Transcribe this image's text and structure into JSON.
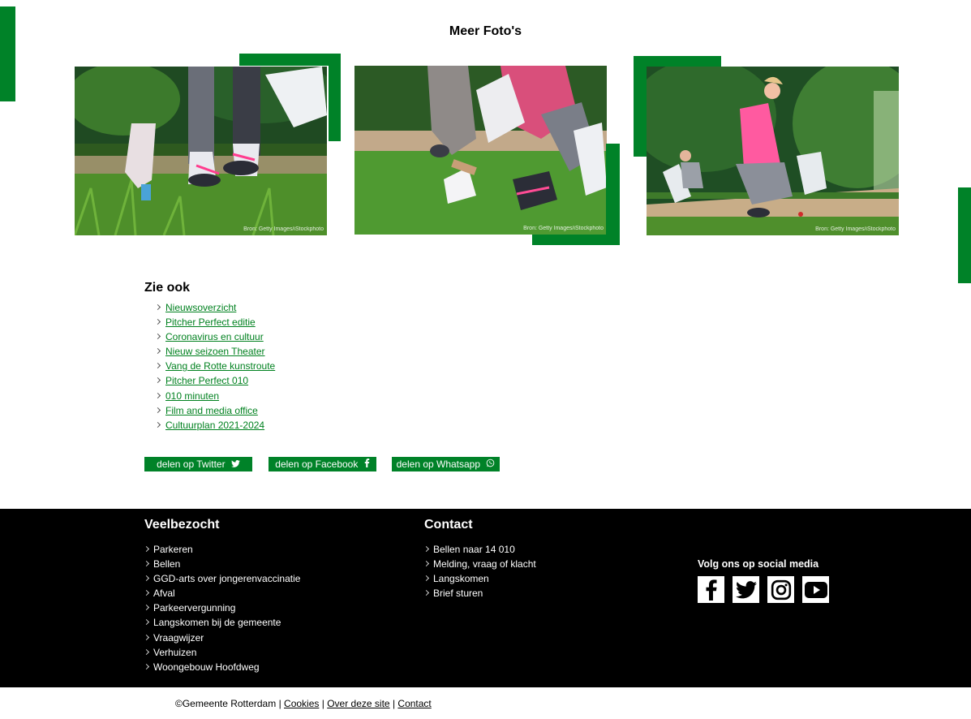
{
  "page_title": "Meer Foto's",
  "photo_credit": "Bron: Getty Images/iStockphoto",
  "see_also": {
    "heading": "Zie ook",
    "links": [
      "Nieuwsoverzicht",
      "Pitcher Perfect editie",
      "Coronavirus en cultuur",
      "Nieuw seizoen Theater",
      "Vang de Rotte kunstroute",
      "Pitcher Perfect 010",
      "010 minuten",
      "Film and media office",
      "Cultuurplan 2021-2024"
    ]
  },
  "share": {
    "twitter": "delen op Twitter",
    "facebook": "delen op Facebook",
    "whatsapp": "delen op Whatsapp"
  },
  "footer": {
    "veelbezocht": {
      "heading": "Veelbezocht",
      "items": [
        "Parkeren",
        "Bellen",
        "GGD-arts over jongerenvaccinatie",
        "Afval",
        "Parkeervergunning",
        "Langskomen bij de gemeente",
        "Vraagwijzer",
        "Verhuizen",
        "Woongebouw Hoofdweg"
      ]
    },
    "contact": {
      "heading": "Contact",
      "items": [
        "Bellen naar 14 010",
        "Melding, vraag of klacht",
        "Langskomen",
        "Brief sturen"
      ]
    },
    "social_heading": "Volg ons op social media",
    "social_icons": [
      "facebook-icon",
      "twitter-icon",
      "instagram-icon",
      "youtube-icon"
    ]
  },
  "bottom": {
    "copyright": "©Gemeente Rotterdam",
    "sep": "|",
    "cookies": "Cookies",
    "about": "Over deze site",
    "contact": "Contact"
  },
  "colors": {
    "brand_green": "#008228",
    "link_green": "#00811f",
    "footer_bg": "#000000"
  }
}
